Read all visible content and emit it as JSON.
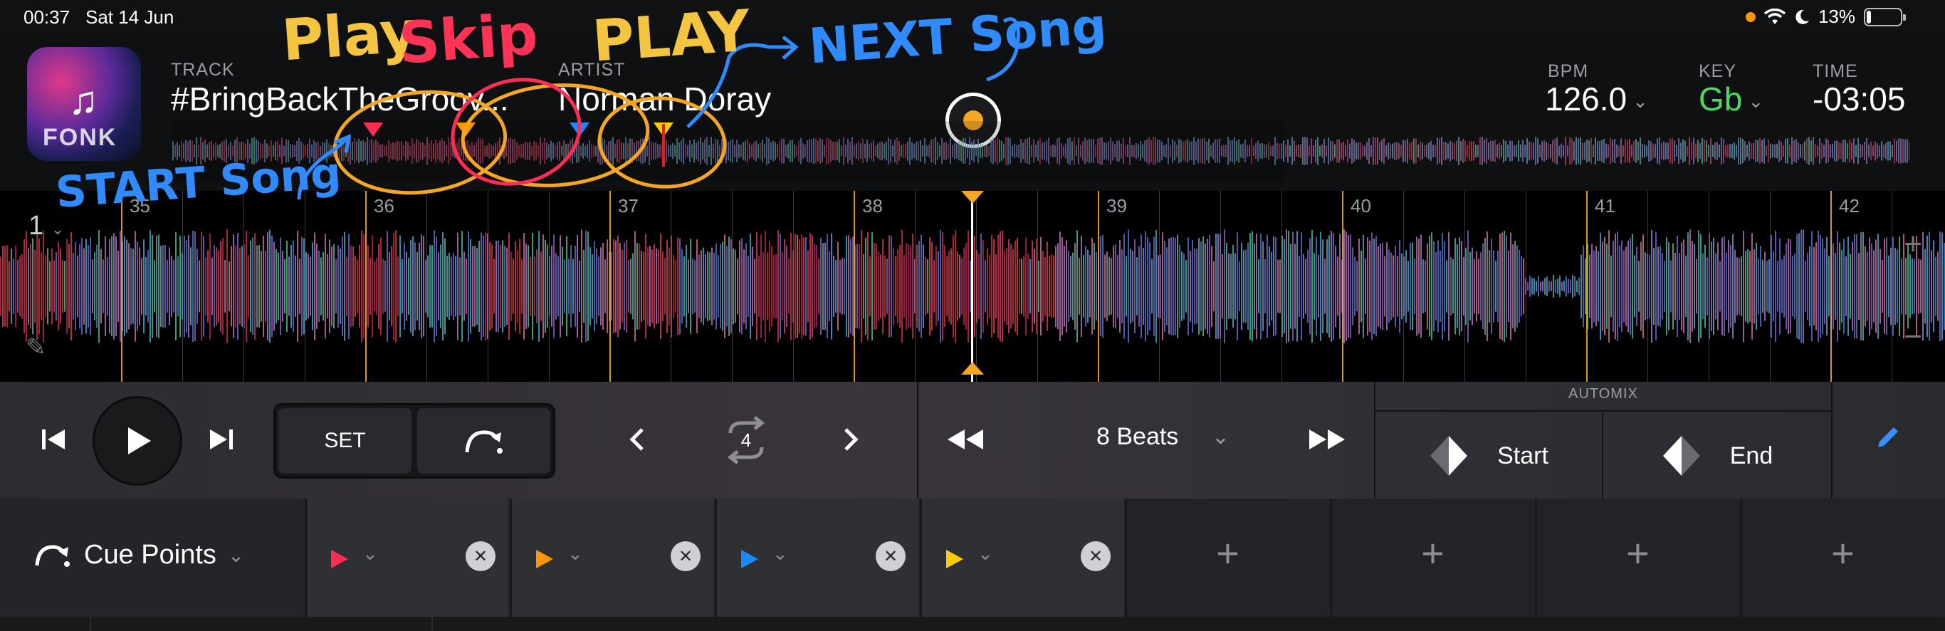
{
  "status": {
    "time": "00:37",
    "date": "Sat 14 Jun",
    "battery": "13%"
  },
  "track": {
    "track_label": "TRACK",
    "track_title": "#BringBackTheGroov...",
    "artist_label": "ARTIST",
    "artist": "Norman Doray",
    "artwork_text": "FONK",
    "bpm_label": "BPM",
    "bpm": "126.0",
    "key_label": "KEY",
    "key": "Gb",
    "time_label": "TIME",
    "time": "-03:05"
  },
  "waveform": {
    "deck": "1",
    "bar_numbers": [
      "35",
      "36",
      "37",
      "38",
      "39",
      "40",
      "41",
      "42"
    ]
  },
  "transport": {
    "set_label": "SET",
    "loop_count": "4",
    "beats_label": "8 Beats",
    "automix_label": "AUTOMIX",
    "start_label": "Start",
    "end_label": "End"
  },
  "cues": {
    "title": "Cue Points",
    "slots": [
      {
        "color": "#ff2d55",
        "set": true
      },
      {
        "color": "#ff9500",
        "set": true
      },
      {
        "color": "#1e88ff",
        "set": true
      },
      {
        "color": "#ffcc00",
        "set": true
      },
      {
        "set": false
      },
      {
        "set": false
      },
      {
        "set": false
      },
      {
        "set": false
      }
    ]
  },
  "annotations": {
    "play_1": "Play",
    "skip": "Skip",
    "play_2": "PLAY",
    "next_song": "NEXT Song",
    "start_song": "START Song"
  },
  "colors": {
    "accent_yellow": "#f5a623",
    "key_green": "#4cd964",
    "edit_blue": "#3a8dff"
  }
}
